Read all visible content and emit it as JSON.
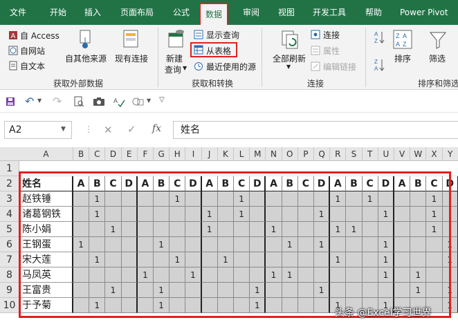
{
  "tabs": [
    {
      "label": "文件"
    },
    {
      "label": "开始"
    },
    {
      "label": "插入"
    },
    {
      "label": "页面布局"
    },
    {
      "label": "公式"
    },
    {
      "label": "数据"
    },
    {
      "label": "审阅"
    },
    {
      "label": "视图"
    },
    {
      "label": "开发工具"
    },
    {
      "label": "帮助"
    },
    {
      "label": "Power Pivot"
    }
  ],
  "active_tab": "数据",
  "ribbon": {
    "external": {
      "access": "自 Access",
      "web": "自网站",
      "text": "自文本",
      "other": "自其他来源",
      "existing": "现有连接",
      "group": "获取外部数据"
    },
    "transform": {
      "new_query_1": "新建",
      "new_query_2": "查询",
      "show_queries": "显示查询",
      "from_table": "从表格",
      "recent_sources": "最近使用的源",
      "group": "获取和转换"
    },
    "connections": {
      "refresh_all": "全部刷新",
      "connections": "连接",
      "properties": "属性",
      "edit_links": "编辑链接",
      "group": "连接"
    },
    "sort": {
      "sort": "排序",
      "filter": "筛选",
      "group": "排序和筛选"
    }
  },
  "formula_bar": {
    "name_box": "A2",
    "formula": "姓名"
  },
  "columns": [
    "A",
    "B",
    "C",
    "D",
    "E",
    "F",
    "G",
    "H",
    "I",
    "J",
    "K",
    "L",
    "M",
    "N",
    "O",
    "P",
    "Q",
    "R",
    "S",
    "T",
    "U",
    "V",
    "W",
    "X",
    "Y"
  ],
  "row_numbers": [
    "1",
    "2",
    "3",
    "4",
    "5",
    "6",
    "7",
    "8",
    "9",
    "10"
  ],
  "table": {
    "header_name": "姓名",
    "header_letters": [
      "A",
      "B",
      "C",
      "D",
      "A",
      "B",
      "C",
      "D",
      "A",
      "B",
      "C",
      "D",
      "A",
      "B",
      "C",
      "D",
      "A",
      "B",
      "C",
      "D",
      "A",
      "B",
      "C",
      "D"
    ],
    "rows": [
      {
        "name": "赵铁锤",
        "cells": [
          "",
          "1",
          "",
          "",
          "",
          "",
          "1",
          "",
          "",
          "",
          "1",
          "",
          "",
          "",
          "",
          "",
          "1",
          "",
          "1",
          "",
          "",
          "",
          "1",
          ""
        ]
      },
      {
        "name": "诸葛钢铁",
        "cells": [
          "",
          "1",
          "",
          "",
          "",
          "",
          "",
          "",
          "1",
          "",
          "1",
          "",
          "",
          "",
          "",
          "1",
          "",
          "",
          "",
          "1",
          "",
          "",
          "1",
          ""
        ]
      },
      {
        "name": "陈小娟",
        "cells": [
          "",
          "",
          "1",
          "",
          "",
          "",
          "",
          "",
          "1",
          "",
          "",
          "",
          "1",
          "",
          "",
          "",
          "1",
          "1",
          "",
          "",
          "",
          "",
          "1",
          ""
        ]
      },
      {
        "name": "王钢蛋",
        "cells": [
          "1",
          "",
          "",
          "",
          "",
          "1",
          "",
          "",
          "",
          "",
          "",
          "",
          "",
          "1",
          "",
          "1",
          "",
          "",
          "",
          "1",
          "",
          "",
          "",
          "1"
        ]
      },
      {
        "name": "宋大莲",
        "cells": [
          "",
          "1",
          "",
          "",
          "",
          "",
          "1",
          "",
          "",
          "1",
          "",
          "",
          "",
          "",
          "",
          "",
          "1",
          "",
          "",
          "1",
          "",
          "",
          "",
          "1"
        ]
      },
      {
        "name": "马凤英",
        "cells": [
          "",
          "",
          "",
          "",
          "1",
          "",
          "",
          "1",
          "",
          "",
          "",
          "",
          "1",
          "1",
          "",
          "",
          "",
          "",
          "",
          "1",
          "",
          "1",
          "",
          ""
        ]
      },
      {
        "name": "王富贵",
        "cells": [
          "",
          "",
          "1",
          "",
          "",
          "1",
          "",
          "",
          "",
          "",
          "",
          "1",
          "",
          "",
          "",
          "1",
          "",
          "",
          "",
          "",
          "",
          "1",
          "",
          "1"
        ]
      },
      {
        "name": "于予菊",
        "cells": [
          "",
          "1",
          "",
          "",
          "",
          "1",
          "",
          "",
          "",
          "",
          "",
          "1",
          "",
          "",
          "",
          "",
          "1",
          "",
          "",
          "1",
          "",
          "",
          "",
          "1"
        ]
      }
    ]
  },
  "watermark": "头条 @Excel学习世界",
  "colors": {
    "accent": "#217346",
    "highlight": "#e02020",
    "cell_fill": "#d2d2d2"
  }
}
